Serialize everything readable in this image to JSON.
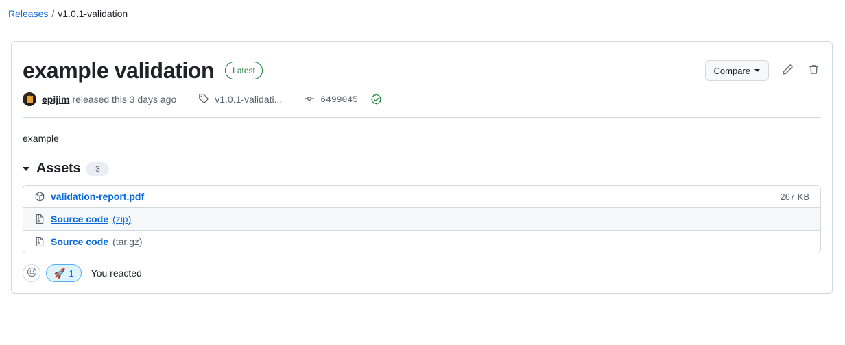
{
  "breadcrumb": {
    "root_label": "Releases",
    "separator": "/",
    "current_label": "v1.0.1-validation"
  },
  "release": {
    "title": "example validation",
    "latest_badge": "Latest",
    "author": "epijim",
    "released_text": "released this 3 days ago",
    "tag_label": "v1.0.1-validati...",
    "commit_sha": "6499045",
    "body": "example",
    "actions": {
      "compare_label": "Compare",
      "edit_icon": "pencil-icon",
      "delete_icon": "trash-icon"
    }
  },
  "assets": {
    "title": "Assets",
    "count": "3",
    "items": [
      {
        "icon": "package-icon",
        "name": "validation-report.pdf",
        "suffix": "",
        "size": "267 KB"
      },
      {
        "icon": "file-zip-icon",
        "name": "Source code",
        "suffix": "(zip)",
        "size": ""
      },
      {
        "icon": "file-zip-icon",
        "name": "Source code",
        "suffix": "(tar.gz)",
        "size": ""
      }
    ]
  },
  "reactions": {
    "add_icon": "smiley-icon",
    "emoji": "🚀",
    "count": "1",
    "status_text": "You reacted"
  },
  "colors": {
    "link": "#0969da",
    "green": "#1a7f37",
    "border": "#d1d9e0",
    "muted": "#59636e",
    "reaction_bg": "#ddf4ff"
  }
}
